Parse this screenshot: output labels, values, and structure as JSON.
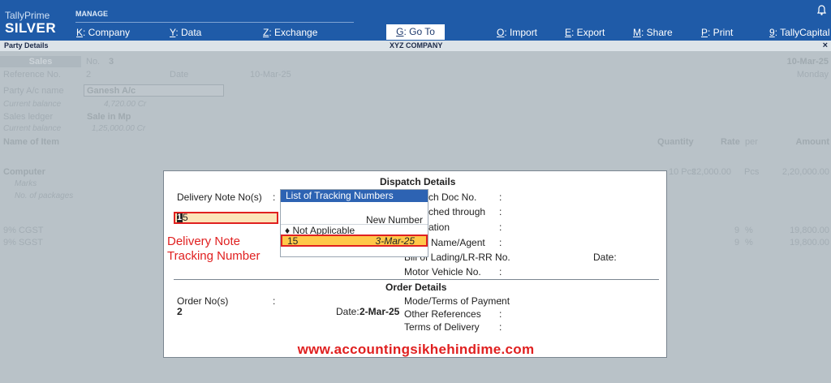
{
  "topbar": {
    "product": "TallyPrime",
    "edition": "SILVER",
    "manage_label": "MANAGE",
    "menu": [
      {
        "key": "K",
        "label": ": Company"
      },
      {
        "key": "Y",
        "label": ": Data"
      },
      {
        "key": "Z",
        "label": ": Exchange"
      },
      {
        "key": "G",
        "label": ": Go To"
      },
      {
        "key": "O",
        "label": ": Import"
      },
      {
        "key": "E",
        "label": ": Export"
      },
      {
        "key": "M",
        "label": ": Share"
      },
      {
        "key": "P",
        "label": ": Print"
      },
      {
        "key": "9",
        "label": ": TallyCapital"
      }
    ],
    "bell_icon": "bell-icon"
  },
  "titlebar": {
    "left": "Party Details",
    "center": "XYZ COMPANY",
    "close": "×"
  },
  "voucher": {
    "type": "Sales",
    "no_label": "No.",
    "no_value": "3",
    "date": "10-Mar-25",
    "day": "Monday",
    "reference_label": "Reference No.",
    "reference_value": "2",
    "date_label": "Date",
    "reference_date": "10-Mar-25",
    "party_label": "Party A/c name",
    "party_value": "Ganesh A/c",
    "current_balance_label": "Current balance",
    "party_balance": "4,720.00 Cr",
    "sales_ledger_label": "Sales ledger",
    "sales_ledger_value": "Sale in Mp",
    "sales_balance": "1,25,000.00 Cr",
    "columns": {
      "item": "Name of Item",
      "quantity": "Quantity",
      "rate": "Rate",
      "per": "per",
      "amount": "Amount"
    },
    "item": {
      "name": "Computer",
      "marks": "Marks",
      "packages": "No. of packages",
      "quantity": "10 Pcs",
      "rate": "22,000.00",
      "per": "Pcs",
      "amount": "2,20,000.00"
    },
    "taxes": [
      {
        "name": "9% CGST",
        "rate": "9",
        "pct": "%",
        "amount": "19,800.00"
      },
      {
        "name": "9% SGST",
        "rate": "9",
        "pct": "%",
        "amount": "19,800.00"
      }
    ]
  },
  "dispatch": {
    "title": "Dispatch Details",
    "delivery_note_label": "Delivery Note No(s)",
    "colon": ":",
    "delivery_note_value": "15",
    "fields": [
      "ch Doc No.",
      "ched through",
      "ation",
      "Name/Agent",
      "Bill of Lading/LR-RR No."
    ],
    "bill_date_label": "Date:",
    "motor_vehicle_label": "Motor Vehicle No."
  },
  "tracking_popup": {
    "title": "List of Tracking Numbers",
    "new_number": "New Number",
    "not_applicable": "Not Applicable",
    "selected_number": "15",
    "selected_date": "3-Mar-25"
  },
  "annotation": {
    "line1": "Delivery Note",
    "line2": "Tracking Number",
    "website": "www.accountingsikhehindime.com"
  },
  "order": {
    "title": "Order Details",
    "order_no_label": "Order No(s)",
    "order_no_value": "2",
    "date_label": "Date:",
    "date_value": "2-Mar-25",
    "mode_label": "Mode/Terms of Payment",
    "other_refs_label": "Other References",
    "terms_label": "Terms of Delivery"
  }
}
